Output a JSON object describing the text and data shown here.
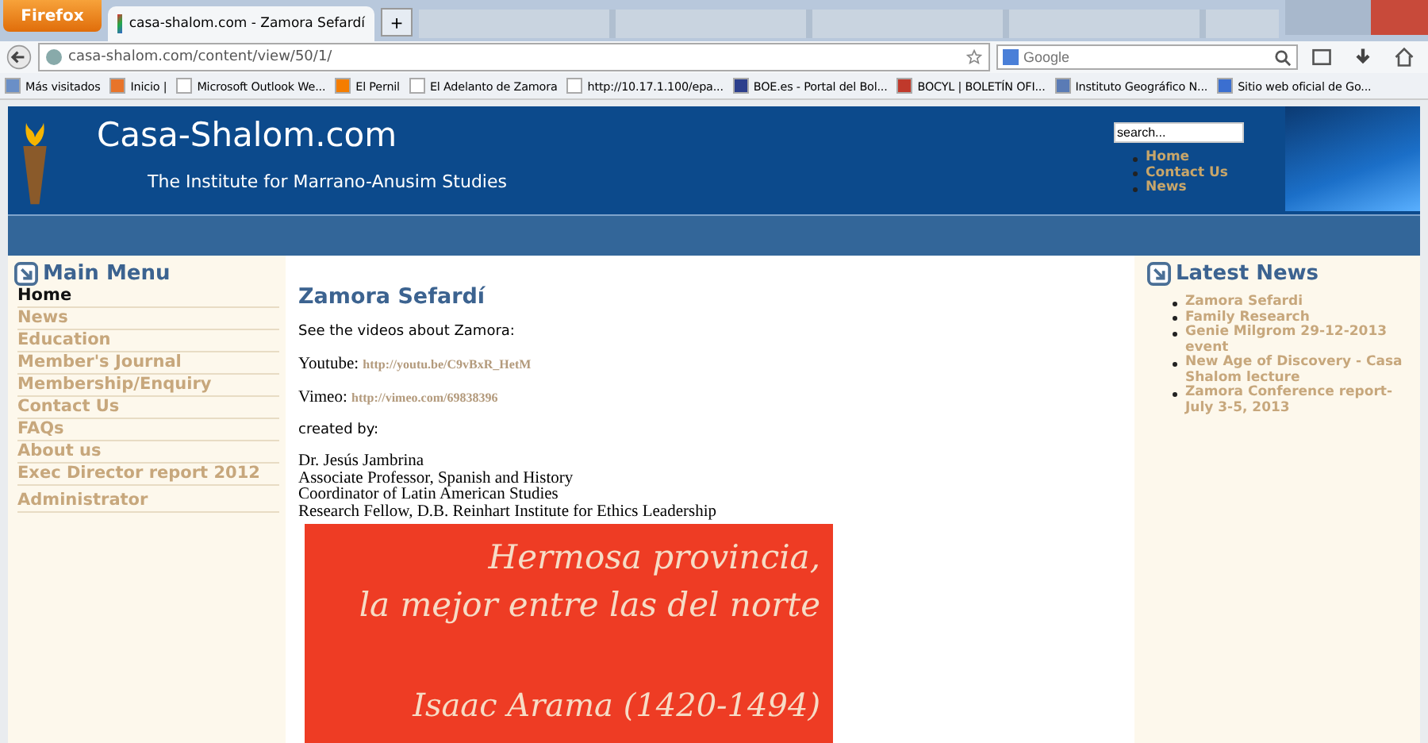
{
  "browser": {
    "app_button": "Firefox",
    "tabs": [
      {
        "title": "casa-shalom.com - Zamora Sefardí",
        "selected": true
      }
    ],
    "new_tab": "+",
    "url": "casa-shalom.com/content/view/50/1/",
    "search_placeholder": "Google",
    "bookmarks": [
      {
        "label": "Más visitados",
        "kind": "gear"
      },
      {
        "label": "Inicio |",
        "kind": "orange"
      },
      {
        "label": "Microsoft Outlook We...",
        "kind": "blank"
      },
      {
        "label": "El Pernil",
        "kind": "blogger"
      },
      {
        "label": "El Adelanto de Zamora",
        "kind": "blank"
      },
      {
        "label": "http://10.17.1.100/epa...",
        "kind": "blank"
      },
      {
        "label": "BOE.es - Portal del Bol...",
        "kind": "boe"
      },
      {
        "label": "BOCYL | BOLETÍN OFI...",
        "kind": "red"
      },
      {
        "label": "Instituto Geográfico N...",
        "kind": "map"
      },
      {
        "label": "Sitio web oficial de Go...",
        "kind": "globe"
      }
    ]
  },
  "header": {
    "site_title": "Casa-Shalom.com",
    "tagline": "The Institute for Marrano-Anusim Studies",
    "search_value": "search...",
    "links": [
      "Home",
      "Contact Us",
      "News"
    ]
  },
  "main_menu": {
    "title": "Main Menu",
    "items": [
      {
        "label": "Home",
        "selected": true
      },
      {
        "label": "News",
        "selected": false
      },
      {
        "label": "Education",
        "selected": false
      },
      {
        "label": "Member's Journal",
        "selected": false
      },
      {
        "label": "Membership/Enquiry",
        "selected": false
      },
      {
        "label": "Contact Us",
        "selected": false
      },
      {
        "label": "FAQs",
        "selected": false
      },
      {
        "label": "About us",
        "selected": false
      },
      {
        "label": "Exec Director report 2012",
        "selected": false
      }
    ],
    "admin": "Administrator"
  },
  "article": {
    "title": "Zamora Sefardí",
    "intro": "See the videos about Zamora:",
    "links": [
      {
        "label": "Youtube:",
        "url": "http://youtu.be/C9vBxR_HetM"
      },
      {
        "label": "Vimeo:",
        "url": "http://vimeo.com/69838396"
      }
    ],
    "created_by": "created by:",
    "author_lines": [
      "Dr. Jesús Jambrina",
      "Associate Professor, Spanish and History",
      "Coordinator of Latin American Studies",
      "Research Fellow, D.B. Reinhart Institute for Ethics Leadership"
    ],
    "banner": {
      "quote_lines": [
        "Hermosa provincia,",
        "la mejor entre las del norte"
      ],
      "attribution": "Isaac Arama (1420-1494)"
    }
  },
  "latest_news": {
    "title": "Latest News",
    "items": [
      "Zamora Sefardi",
      "Family Research",
      "Genie Milgrom 29-12-2013 event",
      "New Age of Discovery - Casa Shalom lecture",
      "Zamora Conference report- July 3-5, 2013"
    ]
  }
}
